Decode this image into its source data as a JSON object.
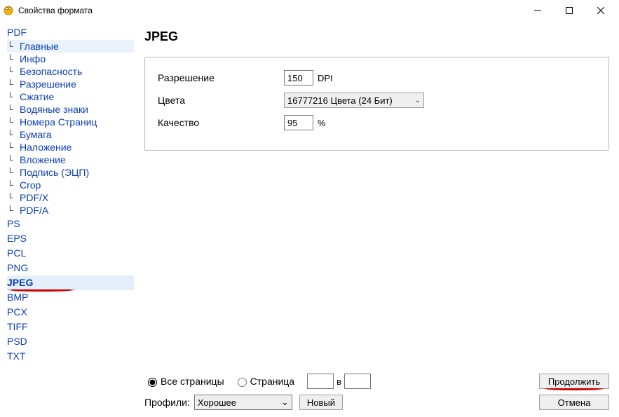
{
  "window": {
    "title": "Свойства формата"
  },
  "sidebar": {
    "roots": [
      {
        "label": "PDF",
        "bold": false
      },
      {
        "label": "PS"
      },
      {
        "label": "EPS"
      },
      {
        "label": "PCL"
      },
      {
        "label": "PNG"
      },
      {
        "label": "JPEG",
        "bold": true,
        "selected": true
      },
      {
        "label": "BMP"
      },
      {
        "label": "PCX"
      },
      {
        "label": "TIFF"
      },
      {
        "label": "PSD"
      },
      {
        "label": "TXT"
      }
    ],
    "pdf_children": [
      {
        "label": "Главные",
        "active": true
      },
      {
        "label": "Инфо"
      },
      {
        "label": "Безопасность"
      },
      {
        "label": "Разрешение"
      },
      {
        "label": "Сжатие"
      },
      {
        "label": "Водяные знаки"
      },
      {
        "label": "Номера Страниц"
      },
      {
        "label": "Бумага"
      },
      {
        "label": "Наложение"
      },
      {
        "label": "Вложение"
      },
      {
        "label": "Подпись   (ЭЦП)"
      },
      {
        "label": "Crop"
      },
      {
        "label": "PDF/X"
      },
      {
        "label": "PDF/A"
      }
    ]
  },
  "main": {
    "title": "JPEG",
    "resolution": {
      "label": "Разрешение",
      "value": "150",
      "unit": "DPI"
    },
    "colors": {
      "label": "Цвета",
      "value": "16777216 Цвета (24 Бит)"
    },
    "quality": {
      "label": "Качество",
      "value": "95",
      "unit": "%"
    }
  },
  "footer": {
    "all_pages": "Все страницы",
    "page": "Страница",
    "in": "в",
    "profiles_label": "Профили:",
    "profile_value": "Хорошее",
    "new_btn": "Новый",
    "continue_btn": "Продолжить",
    "cancel_btn": "Отмена"
  }
}
